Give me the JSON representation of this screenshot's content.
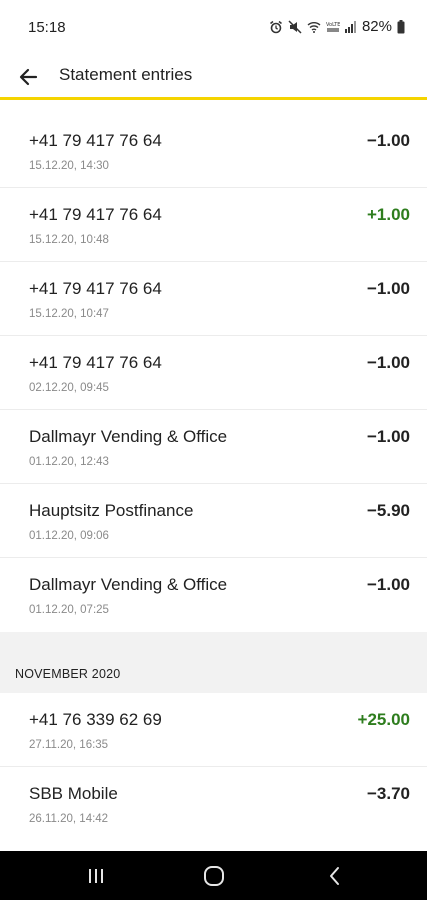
{
  "status_bar": {
    "time": "15:18",
    "battery": "82%",
    "icons": [
      "alarm-icon",
      "mute-icon",
      "wifi-icon",
      "volte-icon",
      "signal-icon",
      "battery-icon"
    ]
  },
  "app_bar": {
    "title": "Statement entries",
    "back_icon": "arrow-left-icon",
    "accent_color": "#f5d400"
  },
  "entries_top": [
    {
      "name": "+41 79 417 76 64",
      "date": "15.12.20, 14:30",
      "amount": "−1.00",
      "positive": false
    },
    {
      "name": "+41 79 417 76 64",
      "date": "15.12.20, 10:48",
      "amount": "+1.00",
      "positive": true
    },
    {
      "name": "+41 79 417 76 64",
      "date": "15.12.20, 10:47",
      "amount": "−1.00",
      "positive": false
    },
    {
      "name": "+41 79 417 76 64",
      "date": "02.12.20, 09:45",
      "amount": "−1.00",
      "positive": false
    },
    {
      "name": "Dallmayr Vending & Office",
      "date": "01.12.20, 12:43",
      "amount": "−1.00",
      "positive": false
    },
    {
      "name": "Hauptsitz Postfinance",
      "date": "01.12.20, 09:06",
      "amount": "−5.90",
      "positive": false
    },
    {
      "name": "Dallmayr Vending & Office",
      "date": "01.12.20, 07:25",
      "amount": "−1.00",
      "positive": false
    }
  ],
  "section": {
    "label": "NOVEMBER 2020"
  },
  "entries_november": [
    {
      "name": "+41 76 339 62 69",
      "date": "27.11.20, 16:35",
      "amount": "+25.00",
      "positive": true
    },
    {
      "name": "SBB Mobile",
      "date": "26.11.20, 14:42",
      "amount": "−3.70",
      "positive": false
    }
  ],
  "colors": {
    "positive_amount": "#2e7d1e",
    "section_background": "#f2f2f2"
  },
  "nav_bar": {
    "icons": [
      "recent-apps-icon",
      "home-icon",
      "back-icon"
    ]
  }
}
